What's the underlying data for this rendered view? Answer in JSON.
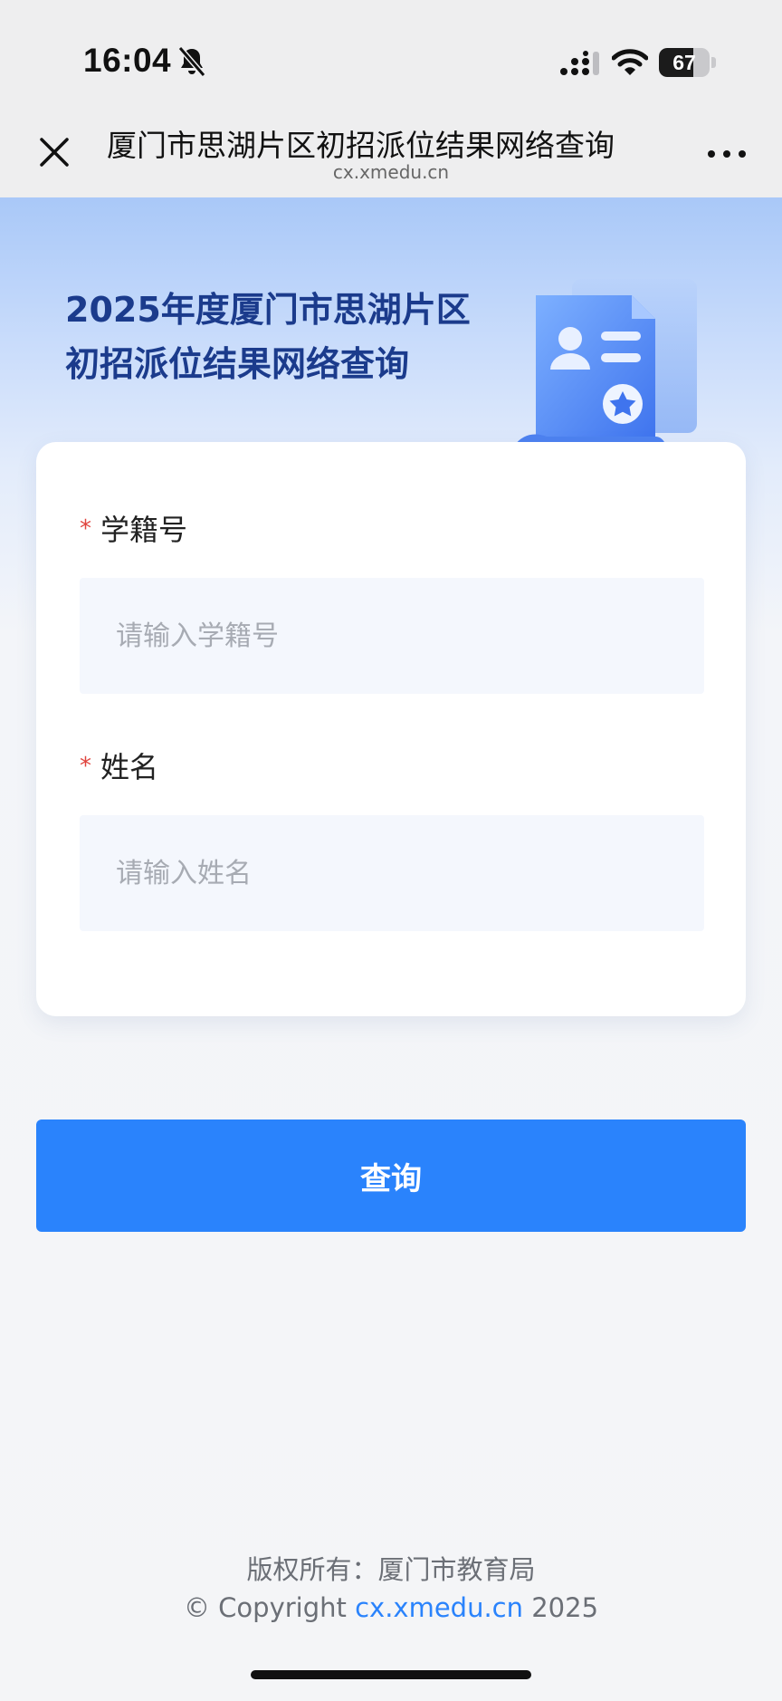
{
  "status_bar": {
    "time": "16:04",
    "battery": "67",
    "battery_level": 0.67,
    "icons": [
      "bell-slash-icon",
      "cellular-signal-icon",
      "wifi-icon",
      "battery-icon"
    ]
  },
  "browser": {
    "title": "厦门市思湖片区初招派位结果网络查询",
    "url": "cx.xmedu.cn",
    "icons": [
      "close-icon",
      "more-icon"
    ]
  },
  "hero": {
    "title_line1": "2025年度厦门市思湖片区",
    "title_line2": "初招派位结果网络查询"
  },
  "form": {
    "required_mark": "*",
    "student_id": {
      "label": "学籍号",
      "placeholder": "请输入学籍号",
      "value": ""
    },
    "name": {
      "label": "姓名",
      "placeholder": "请输入姓名",
      "value": ""
    }
  },
  "actions": {
    "query_label": "查询"
  },
  "footer": {
    "owner": "版权所有：厦门市教育局",
    "copyright_prefix": "© Copyright ",
    "copyright_link": "cx.xmedu.cn",
    "copyright_year": " 2025"
  },
  "colors": {
    "accent": "#2a83fc",
    "title": "#1b3b8c",
    "required": "#e0443e"
  }
}
